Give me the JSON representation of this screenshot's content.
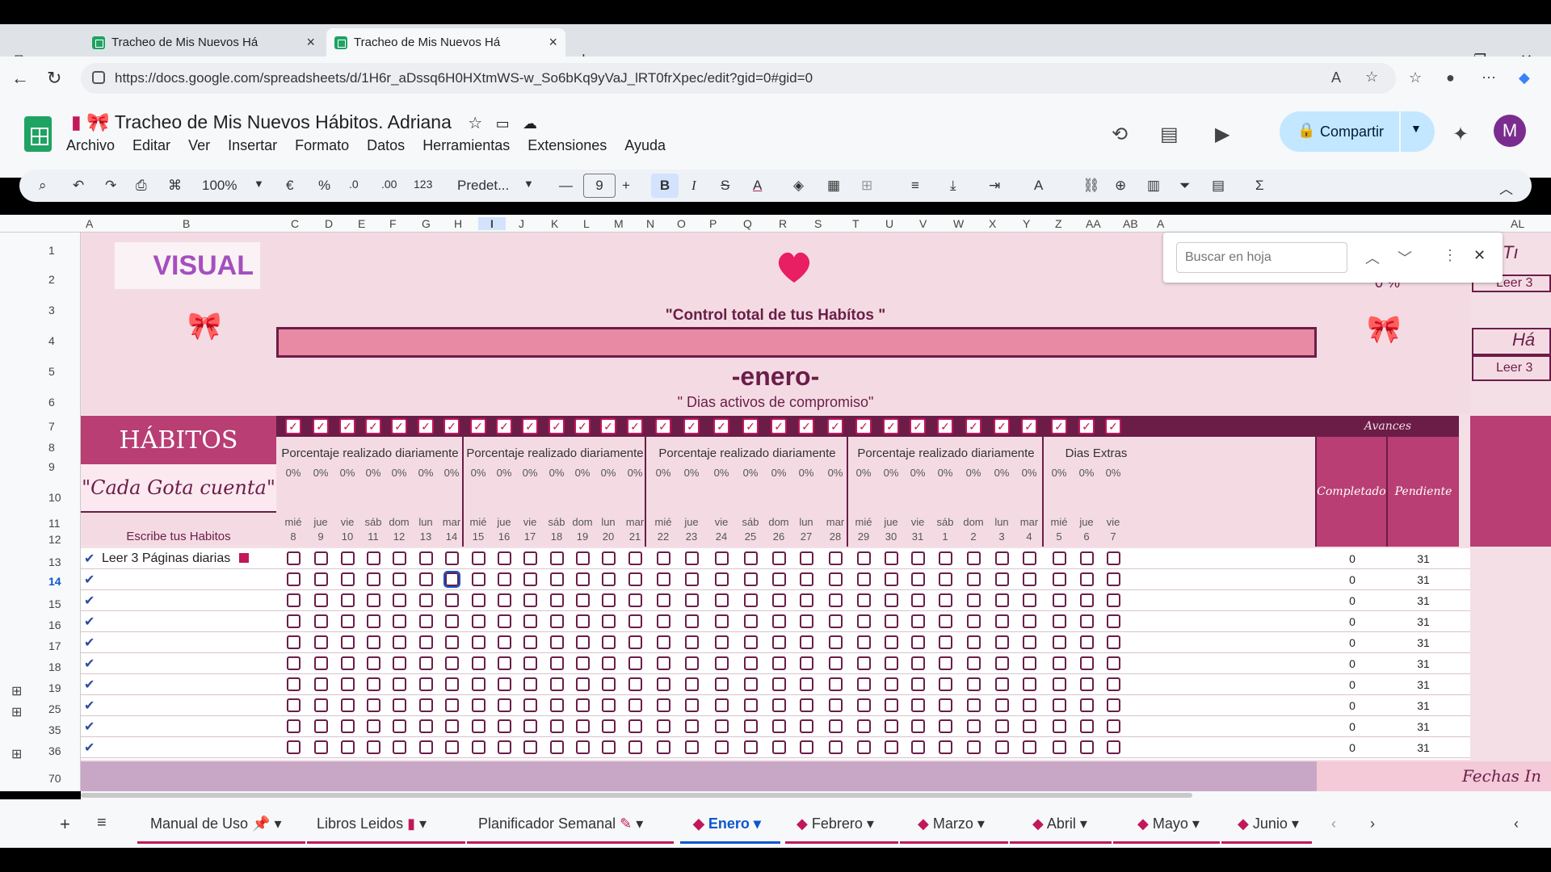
{
  "browser": {
    "tabs": [
      {
        "title": "Tracheo de Mis Nuevos Há"
      },
      {
        "title": "Tracheo de Mis Nuevos Há"
      }
    ],
    "url": "https://docs.google.com/spreadsheets/d/1H6r_aDssq6H0HXtmWS-w_So6bKq9yVaJ_lRT0frXpec/edit?gid=0#gid=0"
  },
  "doc": {
    "title": "Tracheo de Mis Nuevos Hábitos. Adriana",
    "menu": [
      "Archivo",
      "Editar",
      "Ver",
      "Insertar",
      "Formato",
      "Datos",
      "Herramientas",
      "Extensiones",
      "Ayuda"
    ],
    "share_label": "Compartir",
    "avatar": "M"
  },
  "toolbar": {
    "zoom": "100%",
    "currency": "€",
    "percent": "%",
    "dec_dec": ".0",
    "inc_dec": ".00",
    "num_format": "123",
    "font": "Predet...",
    "font_size": "9",
    "bold": "B",
    "italic": "I"
  },
  "columns": [
    "A",
    "B",
    "C",
    "D",
    "E",
    "F",
    "G",
    "H",
    "I",
    "J",
    "K",
    "L",
    "M",
    "N",
    "O",
    "P",
    "Q",
    "R",
    "S",
    "T",
    "U",
    "V",
    "W",
    "X",
    "Y",
    "Z",
    "AA",
    "AB",
    "A",
    "AL"
  ],
  "rows": [
    "1",
    "2",
    "3",
    "4",
    "5",
    "6",
    "7",
    "8",
    "9",
    "10",
    "11",
    "12",
    "13",
    "14",
    "15",
    "16",
    "17",
    "18",
    "19",
    "25",
    "35",
    "36",
    "70"
  ],
  "sheet": {
    "logo_text": "VISUAL",
    "control_title": "\"Control total de tus Habítos \"",
    "month": "-enero-",
    "subtitle": "\" Dias activos de compromiso\"",
    "percent_right": "0 %",
    "habits_header": "HÁBITOS",
    "motto": "\"Cada Gota cuenta\"",
    "write_label": "Escribe tus Habitos",
    "week_titles": [
      "Porcentaje realizado diariamente",
      "Porcentaje realizado diariamente",
      "Porcentaje realizado diariamente",
      "Porcentaje realizado diariamente",
      "Dias Extras"
    ],
    "days": [
      {
        "dow": "mié",
        "n": "8"
      },
      {
        "dow": "jue",
        "n": "9"
      },
      {
        "dow": "vie",
        "n": "10"
      },
      {
        "dow": "sáb",
        "n": "11"
      },
      {
        "dow": "dom",
        "n": "12"
      },
      {
        "dow": "lun",
        "n": "13"
      },
      {
        "dow": "mar",
        "n": "14"
      },
      {
        "dow": "mié",
        "n": "15"
      },
      {
        "dow": "jue",
        "n": "16"
      },
      {
        "dow": "vie",
        "n": "17"
      },
      {
        "dow": "sáb",
        "n": "18"
      },
      {
        "dow": "dom",
        "n": "19"
      },
      {
        "dow": "lun",
        "n": "20"
      },
      {
        "dow": "mar",
        "n": "21"
      },
      {
        "dow": "mié",
        "n": "22"
      },
      {
        "dow": "jue",
        "n": "23"
      },
      {
        "dow": "vie",
        "n": "24"
      },
      {
        "dow": "sáb",
        "n": "25"
      },
      {
        "dow": "dom",
        "n": "26"
      },
      {
        "dow": "lun",
        "n": "27"
      },
      {
        "dow": "mar",
        "n": "28"
      },
      {
        "dow": "mié",
        "n": "29"
      },
      {
        "dow": "jue",
        "n": "30"
      },
      {
        "dow": "vie",
        "n": "31"
      },
      {
        "dow": "sáb",
        "n": "1"
      },
      {
        "dow": "dom",
        "n": "2"
      },
      {
        "dow": "lun",
        "n": "3"
      },
      {
        "dow": "mar",
        "n": "4"
      },
      {
        "dow": "mié",
        "n": "5"
      },
      {
        "dow": "jue",
        "n": "6"
      },
      {
        "dow": "vie",
        "n": "7"
      }
    ],
    "day_percent": "0%",
    "avances": "Avances",
    "completado": "Completado",
    "pendiente": "Pendiente",
    "habit_rows": [
      {
        "name": "Leer 3 Páginas diarias",
        "done": "0",
        "pending": "31"
      },
      {
        "name": "",
        "done": "0",
        "pending": "31"
      },
      {
        "name": "",
        "done": "0",
        "pending": "31"
      },
      {
        "name": "",
        "done": "0",
        "pending": "31"
      },
      {
        "name": "",
        "done": "0",
        "pending": "31"
      },
      {
        "name": "",
        "done": "0",
        "pending": "31"
      },
      {
        "name": "",
        "done": "0",
        "pending": "31"
      },
      {
        "name": "",
        "done": "0",
        "pending": "31"
      },
      {
        "name": "",
        "done": "0",
        "pending": "31"
      },
      {
        "name": "",
        "done": "0",
        "pending": "31"
      }
    ],
    "right_partial": {
      "t": "Tı",
      "leer1": "Leer 3",
      "ha": "Há",
      "leer2": "Leer 3"
    },
    "fechas": "Fechas In"
  },
  "find": {
    "placeholder": "Buscar en hoja"
  },
  "sheet_tabs": [
    "Manual de Uso",
    "Libros Leidos",
    "Planificador Semanal",
    "Enero",
    "Febrero",
    "Marzo",
    "Abril",
    "Mayo",
    "Junio"
  ],
  "active_sheet_tab": "Enero"
}
